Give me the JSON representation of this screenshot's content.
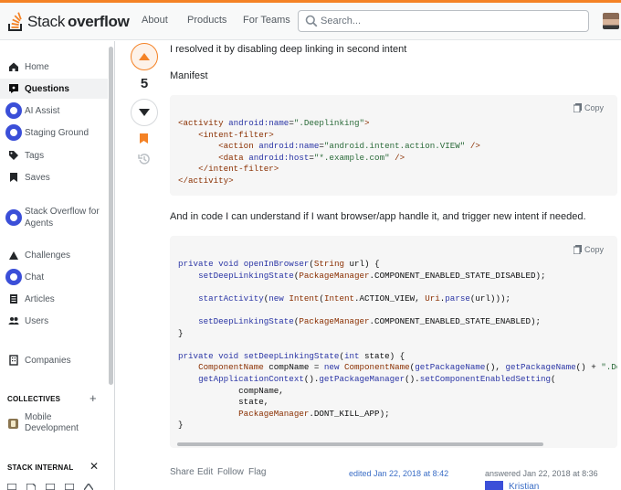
{
  "header": {
    "logo_text_normal": "stack",
    "logo_text_bold": "overflow",
    "nav": [
      "About",
      "Products",
      "For Teams"
    ],
    "search_placeholder": "Search..."
  },
  "sidebar": {
    "items": [
      {
        "label": "Home",
        "icon": "home-icon"
      },
      {
        "label": "Questions",
        "icon": "questions-icon",
        "active": true
      },
      {
        "label": "AI Assist",
        "icon": "ai-assist-icon"
      },
      {
        "label": "Staging Ground",
        "icon": "staging-ground-icon"
      },
      {
        "label": "Tags",
        "icon": "tag-icon"
      },
      {
        "label": "Saves",
        "icon": "bookmark-icon"
      },
      {
        "label_line1": "Stack Overflow for",
        "label_line2": "Agents",
        "icon": "agents-icon"
      },
      {
        "label": "Challenges",
        "icon": "challenges-icon"
      },
      {
        "label": "Chat",
        "icon": "chat-icon"
      },
      {
        "label": "Articles",
        "icon": "articles-icon"
      },
      {
        "label": "Users",
        "icon": "users-icon"
      },
      {
        "label": "Companies",
        "icon": "companies-icon"
      }
    ],
    "collectives_title": "COLLECTIVES",
    "collective_item_line1": "Mobile",
    "collective_item_line2": "Development",
    "stack_internal_title": "STACK INTERNAL"
  },
  "post": {
    "score": "5",
    "intro": "I resolved it by disabling deep linking in second intent",
    "manifest_label": "Manifest",
    "middle_text": "And in code I can understand if I want browser/app handle it, and trigger new intent if needed.",
    "copy_label": "Copy",
    "menu": [
      "Share",
      "Edit",
      "Follow",
      "Flag"
    ],
    "edited": "edited Jan 22, 2018 at 8:42",
    "answered": "answered Jan 22, 2018 at 8:36",
    "author": "Kristian"
  },
  "colors": {
    "accent_orange": "#f48225",
    "link_blue": "#3b6ec6",
    "code_bg": "#f6f6f6"
  }
}
